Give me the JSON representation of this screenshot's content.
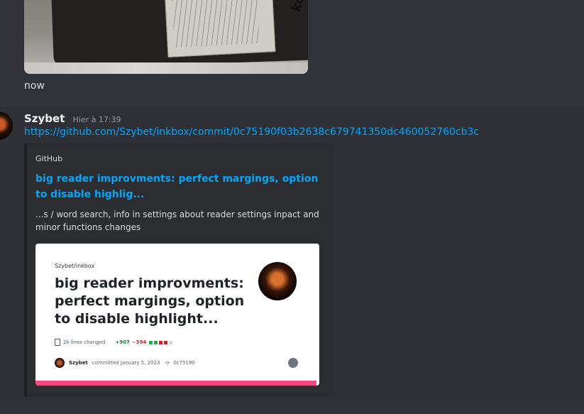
{
  "messages": {
    "prev_text": "now",
    "author": "Szybet",
    "timestamp": "Hier à 17:39",
    "link": "https://github.com/Szybet/inkbox/commit/0c75190f03b2638c679741350dc460052760cb3c"
  },
  "embed": {
    "provider": "GitHub",
    "title": "big reader improvments: perfect margings, option to disable highlig...",
    "description": "...s / word search, info in settings about reader settings inpact and minor functions changes",
    "accent_color": "#1e1f22",
    "preview": {
      "repo": "Szybet/inkbox",
      "title": "big reader improvments: perfect margings, option to disable highlight...",
      "lines_changed": "2k lines changed",
      "additions": "+907",
      "deletions": "−594",
      "user": "Szybet",
      "committed": "committed January 5, 2023",
      "commit_hash": "0c75190",
      "bar_color": "#f5487f"
    }
  },
  "colors": {
    "background": "#313338",
    "highlight": "#2e3035",
    "link": "#00a8fc"
  }
}
